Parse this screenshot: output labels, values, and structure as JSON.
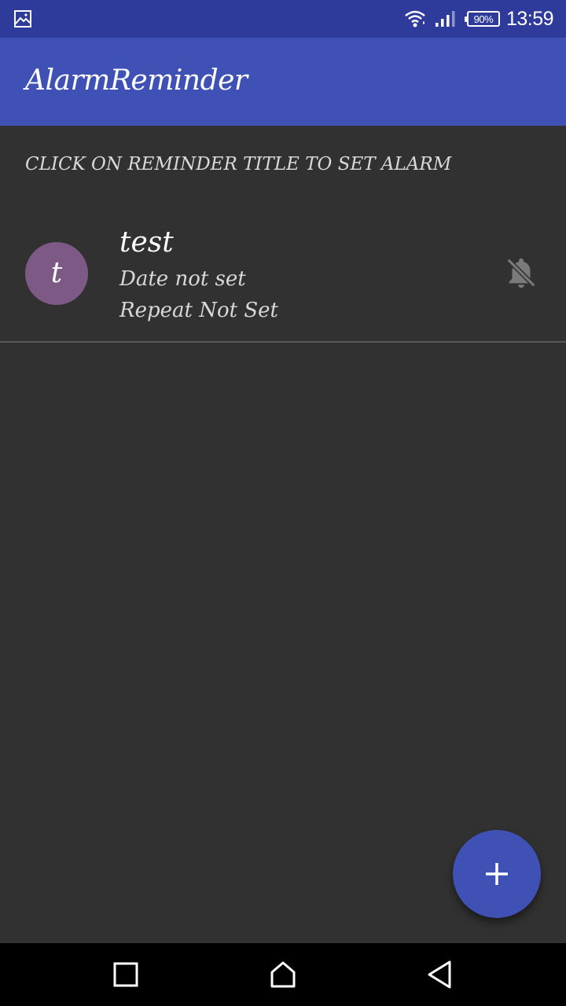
{
  "status_bar": {
    "battery_percent": "90%",
    "time": "13:59"
  },
  "app_bar": {
    "title": "AlarmReminder"
  },
  "hint": "CLICK ON REMINDER TITLE TO SET ALARM",
  "reminders": [
    {
      "avatar_letter": "t",
      "title": "test",
      "date": "Date not set",
      "repeat": "Repeat Not Set",
      "alarm_icon": "bell-off-icon"
    }
  ],
  "colors": {
    "status_bar": "#2f3b9a",
    "primary": "#3f51b5",
    "background": "#313131",
    "avatar": "#7d5a86"
  }
}
